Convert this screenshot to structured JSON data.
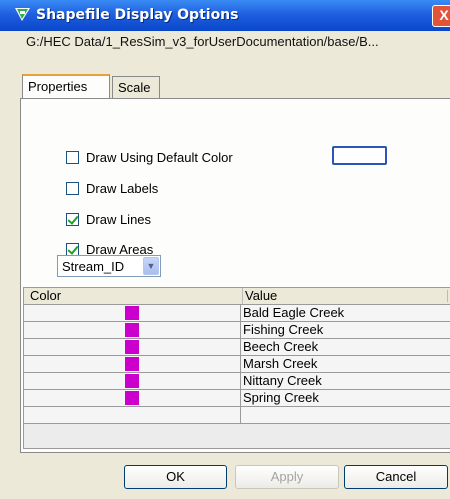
{
  "window": {
    "title": "Shapefile Display Options",
    "close_glyph": "X"
  },
  "path": "G:/HEC Data/1_ResSim_v3_forUserDocumentation/base/B...",
  "tabs": [
    {
      "label": "Properties",
      "selected": true
    },
    {
      "label": "Scale",
      "selected": false
    }
  ],
  "options": {
    "draw_default_color": {
      "label": "Draw Using Default Color",
      "checked": false
    },
    "draw_labels": {
      "label": "Draw Labels",
      "checked": false
    },
    "draw_lines": {
      "label": "Draw Lines",
      "checked": true
    },
    "draw_areas": {
      "label": "Draw Areas",
      "checked": true
    }
  },
  "field_select": {
    "value": "Stream_ID"
  },
  "table": {
    "headers": {
      "color": "Color",
      "value": "Value"
    },
    "rows": [
      {
        "color": "#cc00cc",
        "value": "Bald Eagle Creek"
      },
      {
        "color": "#cc00cc",
        "value": "Fishing Creek"
      },
      {
        "color": "#cc00cc",
        "value": "Beech Creek"
      },
      {
        "color": "#cc00cc",
        "value": "Marsh Creek"
      },
      {
        "color": "#cc00cc",
        "value": "Nittany Creek"
      },
      {
        "color": "#cc00cc",
        "value": "Spring Creek"
      }
    ]
  },
  "buttons": {
    "ok": "OK",
    "apply": "Apply",
    "cancel": "Cancel"
  }
}
